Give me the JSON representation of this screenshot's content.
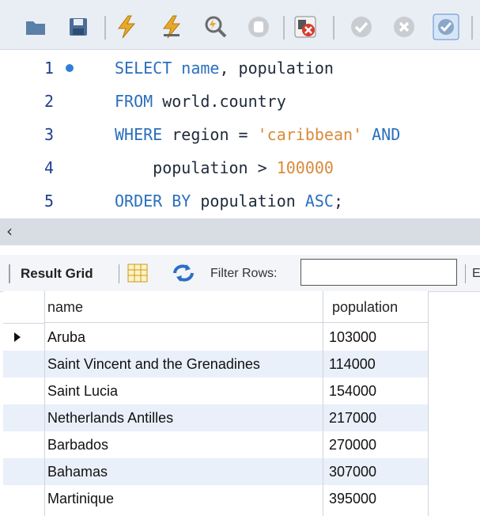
{
  "toolbar": {
    "icons": [
      "open-folder-icon",
      "save-icon",
      "execute-icon",
      "execute-current-icon",
      "explain-icon",
      "stop-icon",
      "toggle-error-icon",
      "commit-icon",
      "rollback-icon",
      "autocommit-icon"
    ]
  },
  "editor": {
    "lines": [
      {
        "num": "1",
        "parts": [
          [
            "kw",
            "SELECT "
          ],
          [
            "kw",
            "name"
          ],
          [
            "txt",
            ", population"
          ]
        ]
      },
      {
        "num": "2",
        "parts": [
          [
            "kw",
            "FROM "
          ],
          [
            "txt",
            "world.country"
          ]
        ]
      },
      {
        "num": "3",
        "parts": [
          [
            "kw",
            "WHERE "
          ],
          [
            "txt",
            "region = "
          ],
          [
            "str",
            "'caribbean'"
          ],
          [
            "kw",
            " AND"
          ]
        ]
      },
      {
        "num": "4",
        "parts": [
          [
            "txt",
            "    population > "
          ],
          [
            "num",
            "100000"
          ]
        ]
      },
      {
        "num": "5",
        "parts": [
          [
            "kw",
            "ORDER BY "
          ],
          [
            "txt",
            "population "
          ],
          [
            "kw",
            "ASC"
          ],
          [
            "txt",
            ";"
          ]
        ]
      }
    ]
  },
  "scrollbar": {
    "left_arrow": "‹"
  },
  "results": {
    "title": "Result Grid",
    "filter_label": "Filter Rows:",
    "filter_value": "",
    "overflow_text": "E",
    "columns": [
      "name",
      "population"
    ],
    "rows": [
      {
        "name": "Aruba",
        "population": "103000"
      },
      {
        "name": "Saint Vincent and the Grenadines",
        "population": "114000"
      },
      {
        "name": "Saint Lucia",
        "population": "154000"
      },
      {
        "name": "Netherlands Antilles",
        "population": "217000"
      },
      {
        "name": "Barbados",
        "population": "270000"
      },
      {
        "name": "Bahamas",
        "population": "307000"
      },
      {
        "name": "Martinique",
        "population": "395000"
      }
    ]
  }
}
